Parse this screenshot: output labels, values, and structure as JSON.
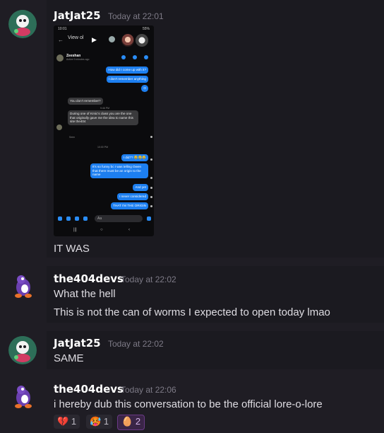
{
  "messages": [
    {
      "author": "JatJat25",
      "time": "Today at 22:01",
      "text": "IT WAS"
    },
    {
      "author": "the404devs",
      "time": "Today at 22:02",
      "lines": [
        "What the hell",
        "This is not the can of worms I expected to open today lmao"
      ]
    },
    {
      "author": "JatJat25",
      "time": "Today at 22:02",
      "text": "SAME"
    },
    {
      "author": "the404devs",
      "time": "Today at 22:06",
      "text": "i hereby dub this conversation to be the official lore-o-lore"
    }
  ],
  "phone": {
    "status_time": "10:01",
    "status_right": "55%",
    "header_title": "View ol",
    "contact_name": "Zeeshan",
    "contact_status": "Active 9 minutes ago",
    "out1": "How did I come up with it?",
    "out2": "I don't remember anything",
    "out3": "O",
    "in1": "You don't remember?",
    "time1": "9:46 PM",
    "in2": "During one of Krnic's class you are the one that originally gave me the idea to name this site the404",
    "seen": "Seen",
    "time2": "10:00 PM",
    "out4": "I did?? 😂😂😂",
    "out5": "It's so funny bc I was telling Owen that there must be an origin to the name",
    "out6": "And yet",
    "out7": "I never considered",
    "out8": "THAT I'M THE ORIGIN",
    "input_placeholder": "Aa"
  },
  "reactions": [
    {
      "emoji": "💔",
      "count": "1"
    },
    {
      "emoji": "🥵",
      "count": "1"
    },
    {
      "emoji": "🥚",
      "count": "2"
    }
  ],
  "colors": {
    "background": "#1f1d24",
    "message_bg": "#1b1a20",
    "messenger_blue": "#1d7ff0",
    "active_reaction": "#3a2547"
  }
}
